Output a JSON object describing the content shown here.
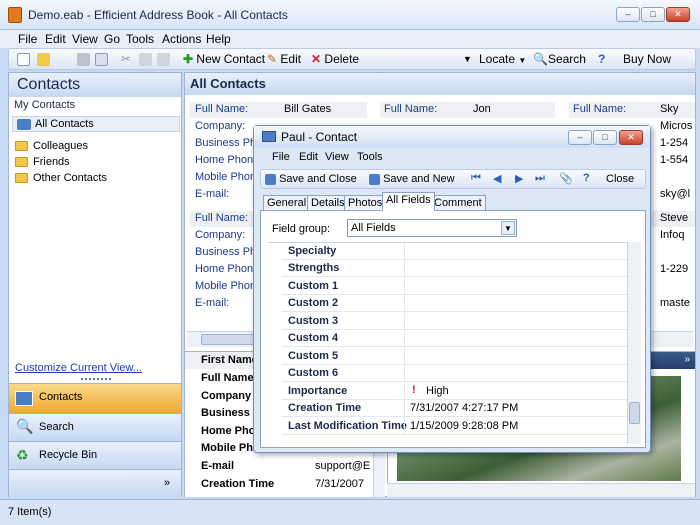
{
  "window": {
    "title": "Demo.eab - Efficient Address Book - All Contacts"
  },
  "menu": [
    "File",
    "Edit",
    "View",
    "Go",
    "Tools",
    "Actions",
    "Help"
  ],
  "toolbar": {
    "new_contact": "New Contact",
    "edit": "Edit",
    "delete": "Delete",
    "locate": "Locate",
    "search": "Search",
    "buy_now": "Buy Now"
  },
  "sidebar": {
    "title": "Contacts",
    "section": "My Contacts",
    "all_contacts": "All Contacts",
    "folders": [
      "Colleagues",
      "Friends",
      "Other Contacts"
    ],
    "customize": "Customize Current View...",
    "nav": [
      "Contacts",
      "Search",
      "Recycle Bin"
    ]
  },
  "main": {
    "title": "All Contacts",
    "card_labels": [
      "Full Name:",
      "Company:",
      "Business Ph",
      "Home Phon",
      "Mobile Phon",
      "E-mail:"
    ],
    "card1": {
      "name": "Bill Gates"
    },
    "card2": {
      "name": "Jon"
    },
    "card3": {
      "name": "Sky",
      "company": "Micros",
      "business": "1-254",
      "home": "1-554",
      "email": "sky@l"
    },
    "card4": {
      "name": "Steve",
      "company": "Infoq",
      "home": "1-229",
      "email": "maste"
    },
    "detail_labels": [
      "First Name",
      "Full Name",
      "Company",
      "Business P",
      "Home Phon",
      "Mobile Pho",
      "E-mail",
      "Creation Time"
    ],
    "detail_values": {
      "email": "support@E",
      "creation": "7/31/2007"
    }
  },
  "status": "7 Item(s)",
  "dialog": {
    "title": "Paul - Contact",
    "menu": [
      "File",
      "Edit",
      "View",
      "Tools"
    ],
    "save_close": "Save and Close",
    "save_new": "Save and New",
    "close": "Close",
    "tabs": [
      "General",
      "Details",
      "Photos",
      "All Fields",
      "Comment"
    ],
    "field_group_label": "Field group:",
    "field_group_value": "All Fields",
    "rows": [
      {
        "name": "Specialty",
        "value": ""
      },
      {
        "name": "Strengths",
        "value": ""
      },
      {
        "name": "Custom 1",
        "value": ""
      },
      {
        "name": "Custom 2",
        "value": ""
      },
      {
        "name": "Custom 3",
        "value": ""
      },
      {
        "name": "Custom 4",
        "value": ""
      },
      {
        "name": "Custom 5",
        "value": ""
      },
      {
        "name": "Custom 6",
        "value": ""
      },
      {
        "name": "Importance",
        "value": "High"
      },
      {
        "name": "Creation Time",
        "value": "7/31/2007 4:27:17 PM"
      },
      {
        "name": "Last Modification Time",
        "value": "1/15/2009 9:28:08 PM"
      }
    ]
  }
}
